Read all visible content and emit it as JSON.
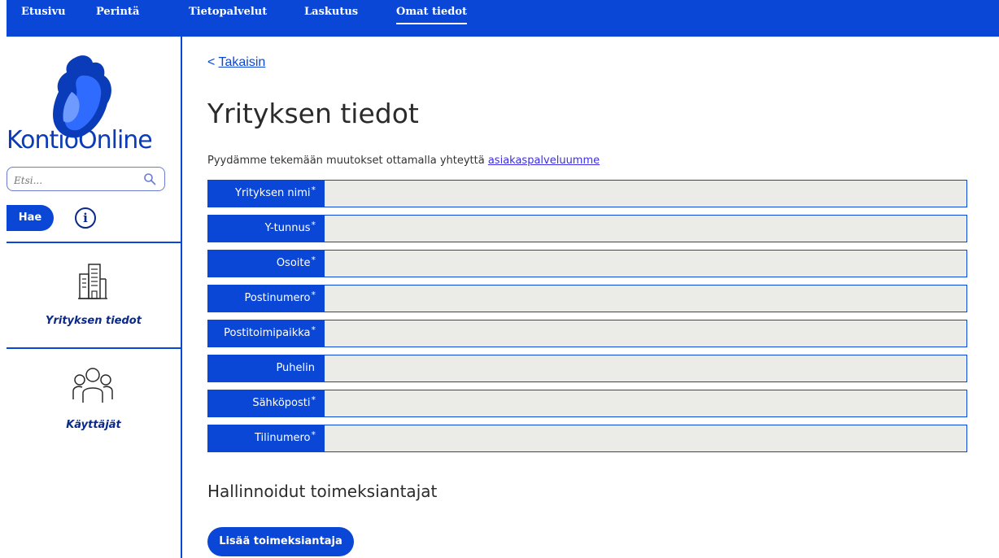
{
  "nav": {
    "items": [
      {
        "label": "Etusivu"
      },
      {
        "label": "Perintä"
      },
      {
        "label": "Tietopalvelut"
      },
      {
        "label": "Laskutus"
      },
      {
        "label": "Omat tiedot"
      }
    ],
    "active": "Omat tiedot"
  },
  "sidebar": {
    "logo_text": "KontioOnline",
    "search": {
      "placeholder": "Etsi..."
    },
    "search_button": "Hae",
    "info_glyph": "i",
    "items": [
      {
        "label": "Yrityksen tiedot",
        "icon": "building-icon"
      },
      {
        "label": "Käyttäjät",
        "icon": "users-icon"
      }
    ]
  },
  "main": {
    "back_prefix": "< ",
    "back_label": "Takaisin",
    "title": "Yrityksen tiedot",
    "intro_text": "Pyydämme tekemään muutokset ottamalla yhteyttä ",
    "intro_link": "asiakaspalveluumme",
    "fields": [
      {
        "label": "Yrityksen nimi",
        "required": "*",
        "value": ""
      },
      {
        "label": "Y-tunnus",
        "required": "*",
        "value": ""
      },
      {
        "label": "Osoite",
        "required": "*",
        "value": ""
      },
      {
        "label": "Postinumero",
        "required": "*",
        "value": ""
      },
      {
        "label": "Postitoimipaikka",
        "required": "*",
        "value": ""
      },
      {
        "label": "Puhelin",
        "required": "",
        "value": ""
      },
      {
        "label": "Sähköposti",
        "required": "*",
        "value": ""
      },
      {
        "label": "Tilinumero",
        "required": "*",
        "value": ""
      }
    ],
    "section_title": "Hallinnoidut toimeksiantajat",
    "add_button": "Lisää toimeksiantaja"
  },
  "colors": {
    "brand": "#0a47d6",
    "field_bg": "#ebebe8"
  }
}
